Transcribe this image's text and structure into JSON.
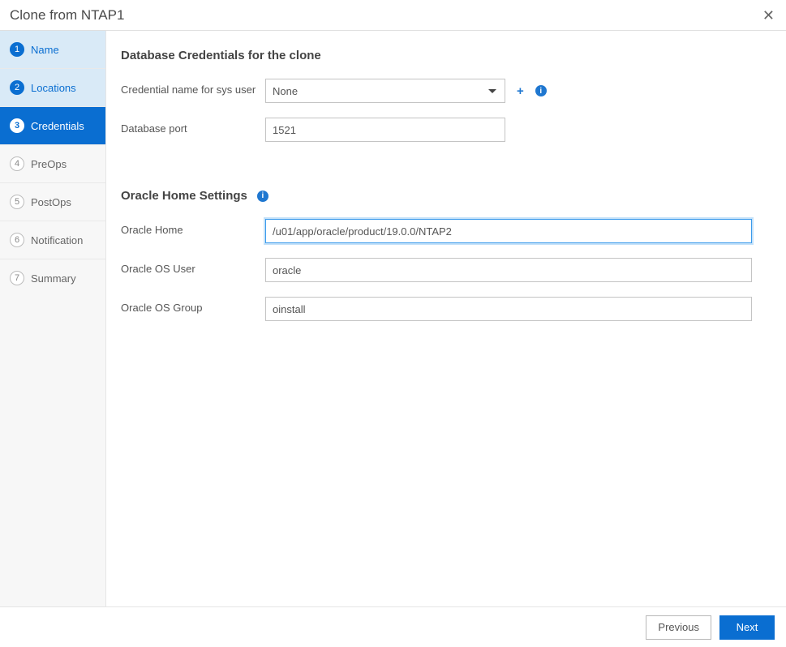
{
  "header": {
    "title": "Clone from NTAP1",
    "close_glyph": "✕"
  },
  "steps": [
    {
      "num": "1",
      "label": "Name",
      "state": "done"
    },
    {
      "num": "2",
      "label": "Locations",
      "state": "done"
    },
    {
      "num": "3",
      "label": "Credentials",
      "state": "active"
    },
    {
      "num": "4",
      "label": "PreOps",
      "state": "future"
    },
    {
      "num": "5",
      "label": "PostOps",
      "state": "future"
    },
    {
      "num": "6",
      "label": "Notification",
      "state": "future"
    },
    {
      "num": "7",
      "label": "Summary",
      "state": "future"
    }
  ],
  "sections": {
    "creds_title": "Database Credentials for the clone",
    "home_title": "Oracle Home Settings"
  },
  "labels": {
    "cred_name": "Credential name for sys user",
    "db_port": "Database port",
    "ohome": "Oracle Home",
    "osuser": "Oracle OS User",
    "osgroup": "Oracle OS Group"
  },
  "fields": {
    "cred_name_selected": "None",
    "db_port": "1521",
    "ohome": "/u01/app/oracle/product/19.0.0/NTAP2",
    "osuser": "oracle",
    "osgroup": "oinstall"
  },
  "icons": {
    "plus": "+",
    "info": "i"
  },
  "footer": {
    "previous": "Previous",
    "next": "Next"
  }
}
